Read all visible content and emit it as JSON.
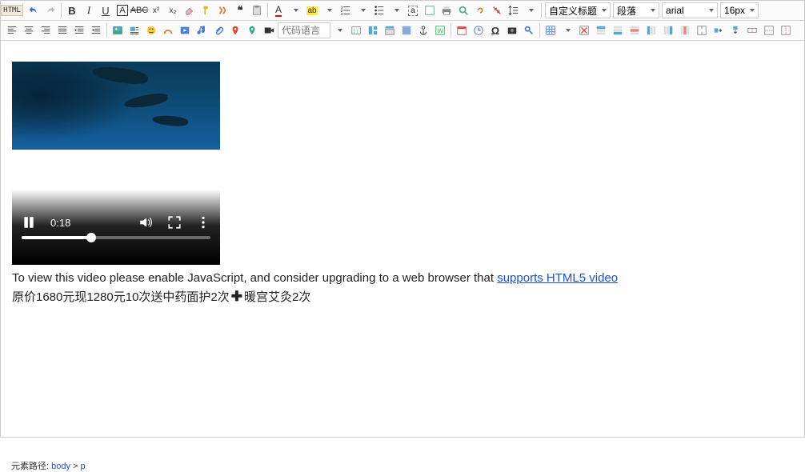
{
  "toolbar": {
    "html_label": "HTML",
    "code_lang_placeholder": "代码语言",
    "custom_title": "自定义标题",
    "paragraph": "段落",
    "font_family": "arial",
    "font_size": "16px"
  },
  "video": {
    "time": "0:18",
    "fallback_prefix": "To view this video please enable JavaScript, and consider upgrading to a web browser that ",
    "fallback_link": "supports HTML5 video"
  },
  "content": {
    "line2_a": "原价1680元现1280元10次送中药面护2次",
    "line2_b": "暖宫艾灸2次"
  },
  "path": {
    "label": "元素路径:",
    "n1": "body",
    "sep": " > ",
    "n2": "p"
  }
}
